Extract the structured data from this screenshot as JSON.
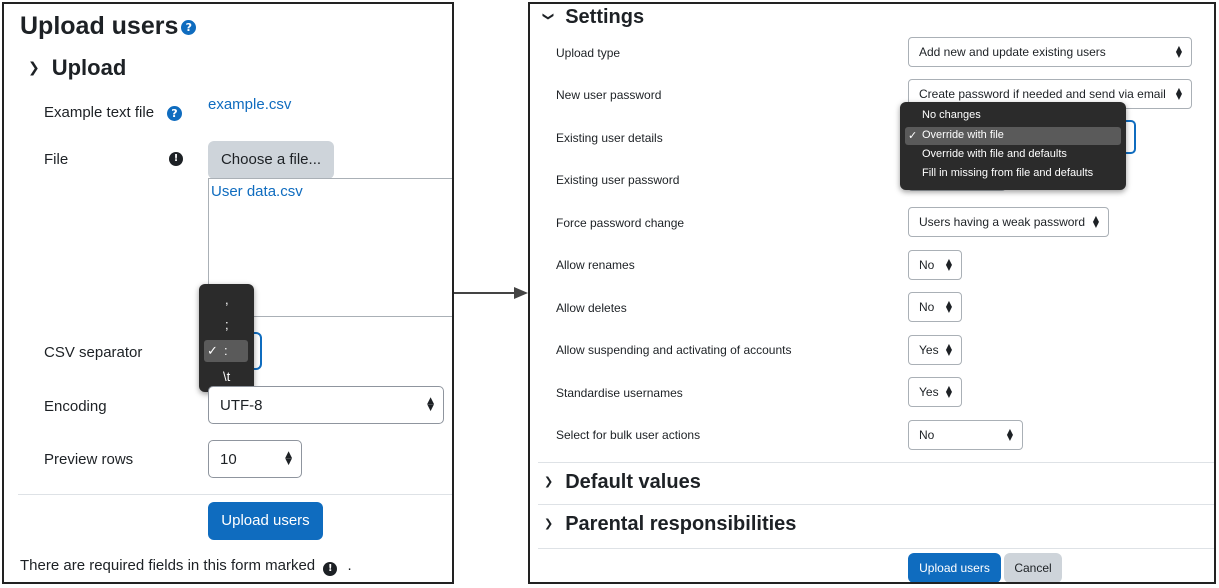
{
  "left": {
    "page_title": "Upload users",
    "section_title": "Upload",
    "example_label": "Example text file",
    "example_link": "example.csv",
    "file_label": "File",
    "choose_button": "Choose a file...",
    "uploaded_file": "User data.csv",
    "csv_label": "CSV separator",
    "csv_options": [
      ",",
      ";",
      ":",
      "\\t"
    ],
    "csv_selected_mark": "✓",
    "encoding_label": "Encoding",
    "encoding_value": "UTF-8",
    "preview_label": "Preview rows",
    "preview_value": "10",
    "upload_button": "Upload users",
    "required_note": "There are required fields in this form marked",
    "required_note_end": "."
  },
  "right": {
    "settings_title": "Settings",
    "rows": [
      {
        "label": "Upload type",
        "value": "Add new and update existing users"
      },
      {
        "label": "New user password",
        "value": "Create password if needed and send via email"
      },
      {
        "label": "Existing user details",
        "value": ""
      },
      {
        "label": "Existing user password",
        "value": ""
      },
      {
        "label": "Force password change",
        "value": "Users having a weak password"
      },
      {
        "label": "Allow renames",
        "value": "No"
      },
      {
        "label": "Allow deletes",
        "value": "No"
      },
      {
        "label": "Allow suspending and activating of accounts",
        "value": "Yes"
      },
      {
        "label": "Standardise usernames",
        "value": "Yes"
      },
      {
        "label": "Select for bulk user actions",
        "value": "No"
      }
    ],
    "details_options": [
      "No changes",
      "Override with file",
      "Override with file and defaults",
      "Fill in missing from file and defaults"
    ],
    "details_selected_mark": "✓",
    "default_values": "Default values",
    "parental": "Parental responsibilities",
    "upload_button": "Upload users",
    "cancel_button": "Cancel"
  },
  "icons": {
    "help": "question-circle-icon",
    "required": "exclamation-circle-icon",
    "arrow": "right-arrow-icon"
  },
  "colors": {
    "primary": "#0f6cbf",
    "secondary": "#ced4da",
    "dark_menu": "#2b2b2b"
  }
}
